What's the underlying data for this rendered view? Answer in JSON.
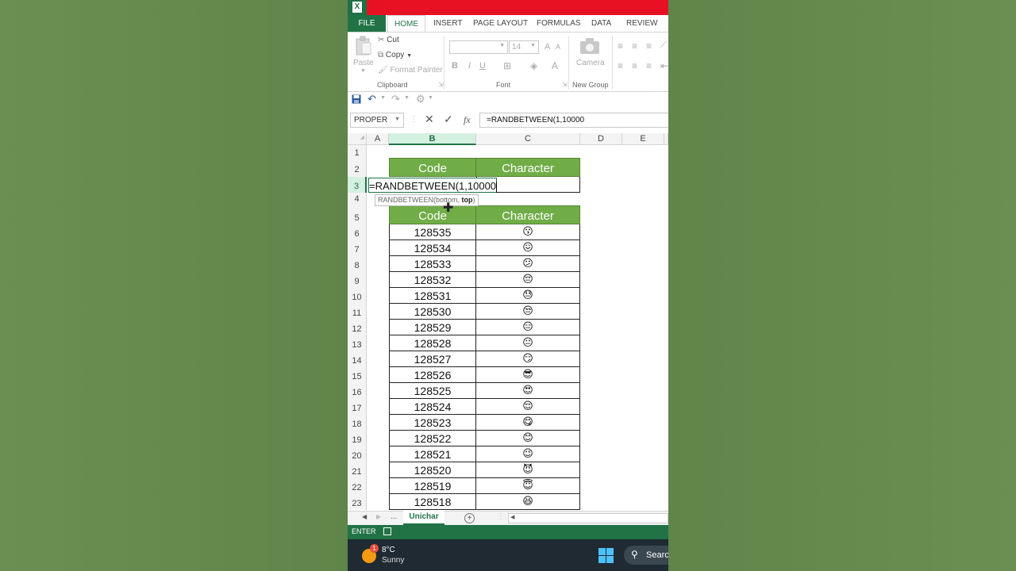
{
  "ribbon_tabs": [
    "FILE",
    "HOME",
    "INSERT",
    "PAGE LAYOUT",
    "FORMULAS",
    "DATA",
    "REVIEW"
  ],
  "clipboard": {
    "paste": "Paste",
    "cut": "Cut",
    "copy": "Copy",
    "format_painter": "Format Painter",
    "group": "Clipboard"
  },
  "font": {
    "size": "14",
    "bold": "B",
    "italic": "I",
    "underline": "U",
    "grow": "A",
    "shrink": "A",
    "color": "A",
    "group": "Font"
  },
  "newgroup": {
    "camera": "Camera",
    "group": "New Group"
  },
  "formula_bar": {
    "name_box": "PROPER",
    "fx": "fx",
    "formula": "=RANDBETWEEN(1,10000"
  },
  "columns": [
    "A",
    "B",
    "C",
    "D",
    "E"
  ],
  "edit": {
    "text": "=RANDBETWEEN(1,10000",
    "tooltip_func": "RANDBETWEEN(bottom, ",
    "tooltip_arg": "top",
    ")": ")"
  },
  "table1": {
    "code_header": "Code",
    "char_header": "Character"
  },
  "table2": {
    "code_header": "Code",
    "char_header": "Character",
    "rows": [
      {
        "row": "6",
        "code": "128535",
        "char": "😗"
      },
      {
        "row": "7",
        "code": "128534",
        "char": "😖"
      },
      {
        "row": "8",
        "code": "128533",
        "char": "😕"
      },
      {
        "row": "9",
        "code": "128532",
        "char": "😔"
      },
      {
        "row": "10",
        "code": "128531",
        "char": "😓"
      },
      {
        "row": "11",
        "code": "128530",
        "char": "😒"
      },
      {
        "row": "12",
        "code": "128529",
        "char": "😑"
      },
      {
        "row": "13",
        "code": "128528",
        "char": "😐"
      },
      {
        "row": "14",
        "code": "128527",
        "char": "😏"
      },
      {
        "row": "15",
        "code": "128526",
        "char": "😎"
      },
      {
        "row": "16",
        "code": "128525",
        "char": "😍"
      },
      {
        "row": "17",
        "code": "128524",
        "char": "😌"
      },
      {
        "row": "18",
        "code": "128523",
        "char": "😋"
      },
      {
        "row": "19",
        "code": "128522",
        "char": "😊"
      },
      {
        "row": "20",
        "code": "128521",
        "char": "😉"
      },
      {
        "row": "21",
        "code": "128520",
        "char": "😈"
      },
      {
        "row": "22",
        "code": "128519",
        "char": "😇"
      },
      {
        "row": "23",
        "code": "128518",
        "char": "😆"
      }
    ]
  },
  "row_numbers": [
    "1",
    "2",
    "3",
    "4",
    "5"
  ],
  "sheet": {
    "tab": "Unichar",
    "more": "..."
  },
  "status": {
    "mode": "ENTER"
  },
  "taskbar": {
    "temp": "8°C",
    "weather": "Sunny",
    "badge": "1",
    "search": "Search"
  },
  "colors": {
    "excel_green": "#217346",
    "header_green": "#70ad47",
    "title_red": "#e81123"
  }
}
